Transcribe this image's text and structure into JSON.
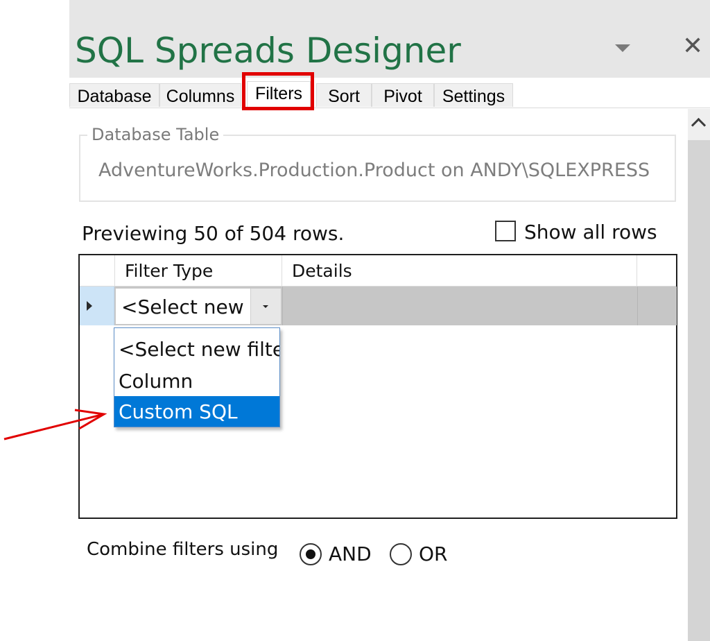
{
  "window": {
    "title": "SQL Spreads Designer",
    "collapse_icon": "chevron-down-icon",
    "close_icon": "close-icon",
    "close_glyph": "✕"
  },
  "tabs": [
    {
      "label": "Database"
    },
    {
      "label": "Columns"
    },
    {
      "label": "Filters",
      "active": true,
      "highlighted": true
    },
    {
      "label": "Sort"
    },
    {
      "label": "Pivot"
    },
    {
      "label": "Settings"
    }
  ],
  "database_table": {
    "legend": "Database Table",
    "value": "AdventureWorks.Production.Product on ANDY\\SQLEXPRESS"
  },
  "preview": {
    "text": "Previewing 50 of 504 rows.",
    "show_all_rows_label": "Show all rows",
    "show_all_rows_checked": false
  },
  "filter_grid": {
    "columns": [
      "Filter Type",
      "Details"
    ],
    "rows": [
      {
        "filter_type": "<Select new filter>",
        "details": ""
      }
    ]
  },
  "dropdown": {
    "options": [
      "<Select new filter>",
      "Column",
      "Custom SQL"
    ],
    "selected": "Custom SQL"
  },
  "combine": {
    "label": "Combine filters using",
    "options": [
      {
        "label": "AND",
        "checked": true
      },
      {
        "label": "OR",
        "checked": false
      }
    ]
  },
  "colors": {
    "title": "#217346",
    "highlight_box": "#e10000",
    "annotation_arrow": "#e10000",
    "selection": "#0078d7"
  }
}
